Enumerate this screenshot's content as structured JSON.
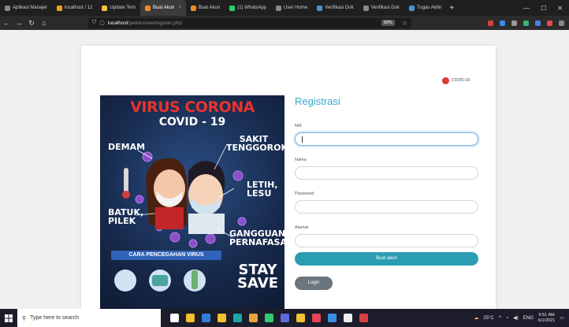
{
  "browser": {
    "tabs": [
      {
        "label": "Aplikasi Manajer",
        "color": "#888888"
      },
      {
        "label": "localhost / 12",
        "color": "#f0a020"
      },
      {
        "label": "Update Tern",
        "color": "#f7c23a"
      },
      {
        "label": "Buat Akun",
        "color": "#f08a24",
        "active": true
      },
      {
        "label": "Buat Akun",
        "color": "#f08a24"
      },
      {
        "label": "(1) WhatsApp",
        "color": "#25d366"
      },
      {
        "label": "User Home",
        "color": "#888888"
      },
      {
        "label": "Verifikasi Dok",
        "color": "#4a90d9"
      },
      {
        "label": "Verifikasi Dok",
        "color": "#888888"
      },
      {
        "label": "Tugas Akhir",
        "color": "#4a90d9"
      }
    ],
    "new_tab": "+",
    "url_host": "localhost",
    "url_path": "/pekansiwe/register.php",
    "zoom": "90%",
    "extension_colors": [
      "#d94040",
      "#3a8ee6",
      "#999999",
      "#3cb371",
      "#4d7fe0",
      "#e24b4b",
      "#888888"
    ]
  },
  "poster": {
    "title": "VIRUS CORONA",
    "subtitle": "COVID - 19",
    "symptoms_left": [
      "DEMAM",
      "BATUK, PILEK"
    ],
    "symptoms_right": [
      "SAKIT TENGGOROKAN",
      "LETIH, LESU",
      "GANGGUAN PERNAFASAN"
    ],
    "prevention": "CARA PENCEGAHAN VIRUS",
    "stay": "STAY",
    "safe": "SAVE"
  },
  "logo": {
    "line1": "COVID-19",
    "line2": ""
  },
  "form": {
    "title": "Registrasi",
    "fields": [
      {
        "label": "NIK",
        "value": ""
      },
      {
        "label": "Nama",
        "value": ""
      },
      {
        "label": "Password",
        "value": ""
      },
      {
        "label": "Alamat",
        "value": ""
      }
    ],
    "submit": "Buat akun",
    "login": "Login"
  },
  "taskbar": {
    "search_placeholder": "Type here to search",
    "weather": "25°C",
    "lang": "ENG",
    "time": "9:51 AM",
    "date": "6/1/2021",
    "app_colors": [
      "#ffffff",
      "#f2c12e",
      "#2f7fd6",
      "#f2c12e",
      "#1aa6a6",
      "#e8a23a",
      "#2ecc71",
      "#5b6bd8",
      "#f2c12e",
      "#e8455a",
      "#3a8ee6",
      "#eeeeee",
      "#d94040"
    ]
  }
}
